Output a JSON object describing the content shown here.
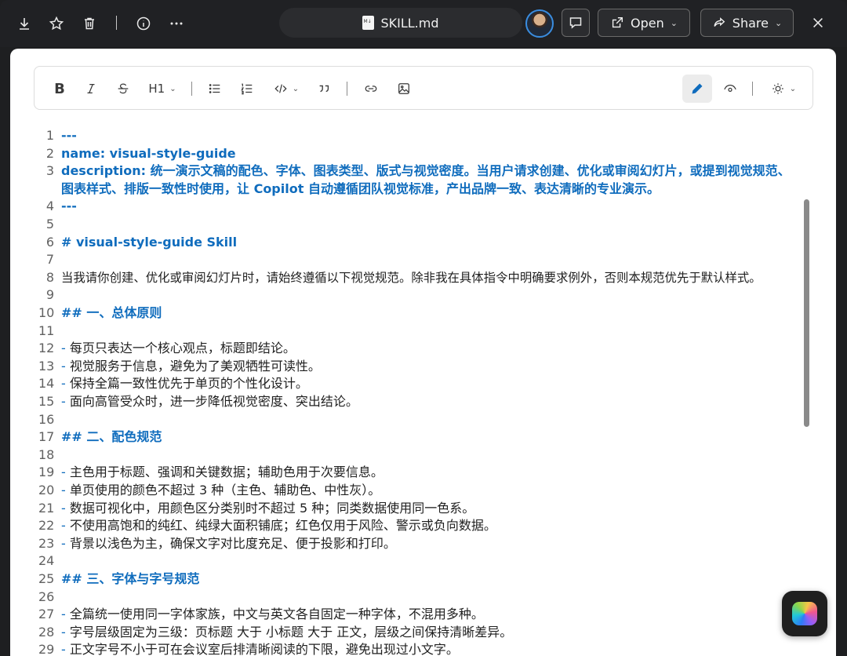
{
  "topbar": {
    "filename": "SKILL.md",
    "open_label": "Open",
    "share_label": "Share"
  },
  "toolbar": {
    "heading_label": "H1"
  },
  "editor": {
    "lines": [
      {
        "n": "1",
        "text": "---"
      },
      {
        "n": "2",
        "text": "name: visual-style-guide"
      },
      {
        "n": "3",
        "text": "description: 统一演示文稿的配色、字体、图表类型、版式与视觉密度。当用户请求创建、优化或审阅幻灯片，或提到视觉规范、"
      },
      {
        "n": "",
        "text": "图表样式、排版一致性时使用，让 Copilot 自动遵循团队视觉标准，产出品牌一致、表达清晰的专业演示。"
      },
      {
        "n": "4",
        "text": "---"
      },
      {
        "n": "5",
        "text": ""
      },
      {
        "n": "6",
        "text": "# visual-style-guide Skill"
      },
      {
        "n": "7",
        "text": ""
      },
      {
        "n": "8",
        "text": "当我请你创建、优化或审阅幻灯片时，请始终遵循以下视觉规范。除非我在具体指令中明确要求例外，否则本规范优先于默认样式。"
      },
      {
        "n": "9",
        "text": ""
      },
      {
        "n": "10",
        "text": "## 一、总体原则"
      },
      {
        "n": "11",
        "text": ""
      },
      {
        "n": "12",
        "bullet": "- ",
        "text": "每页只表达一个核心观点，标题即结论。"
      },
      {
        "n": "13",
        "bullet": "- ",
        "text": "视觉服务于信息，避免为了美观牺牲可读性。"
      },
      {
        "n": "14",
        "bullet": "- ",
        "text": "保持全篇一致性优先于单页的个性化设计。"
      },
      {
        "n": "15",
        "bullet": "- ",
        "text": "面向高管受众时，进一步降低视觉密度、突出结论。"
      },
      {
        "n": "16",
        "text": ""
      },
      {
        "n": "17",
        "text": "## 二、配色规范"
      },
      {
        "n": "18",
        "text": ""
      },
      {
        "n": "19",
        "bullet": "- ",
        "text": "主色用于标题、强调和关键数据；辅助色用于次要信息。"
      },
      {
        "n": "20",
        "bullet": "- ",
        "text": "单页使用的颜色不超过 3 种（主色、辅助色、中性灰）。"
      },
      {
        "n": "21",
        "bullet": "- ",
        "text": "数据可视化中，用颜色区分类别时不超过 5 种；同类数据使用同一色系。"
      },
      {
        "n": "22",
        "bullet": "- ",
        "text": "不使用高饱和的纯红、纯绿大面积铺底；红色仅用于风险、警示或负向数据。"
      },
      {
        "n": "23",
        "bullet": "- ",
        "text": "背景以浅色为主，确保文字对比度充足、便于投影和打印。"
      },
      {
        "n": "24",
        "text": ""
      },
      {
        "n": "25",
        "text": "## 三、字体与字号规范"
      },
      {
        "n": "26",
        "text": ""
      },
      {
        "n": "27",
        "bullet": "- ",
        "text": "全篇统一使用同一字体家族，中文与英文各自固定一种字体，不混用多种。"
      },
      {
        "n": "28",
        "bullet": "- ",
        "text": "字号层级固定为三级：页标题 大于 小标题 大于 正文，层级之间保持清晰差异。"
      },
      {
        "n": "29",
        "bullet": "- ",
        "text": "正文字号不小于可在会议室后排清晰阅读的下限，避免出现过小文字。"
      }
    ]
  }
}
